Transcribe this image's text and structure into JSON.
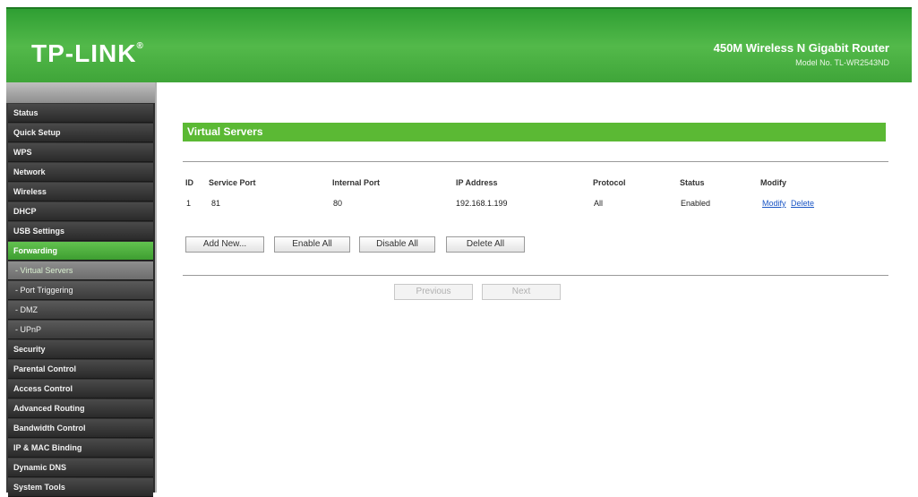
{
  "header": {
    "logo_text": "TP-LINK",
    "logo_mark": "®",
    "product_name": "450M Wireless N Gigabit Router",
    "model_no": "Model No. TL-WR2543ND"
  },
  "sidebar": {
    "items": [
      {
        "label": "Status"
      },
      {
        "label": "Quick Setup"
      },
      {
        "label": "WPS"
      },
      {
        "label": "Network"
      },
      {
        "label": "Wireless"
      },
      {
        "label": "DHCP"
      },
      {
        "label": "USB Settings"
      },
      {
        "label": "Forwarding"
      },
      {
        "label": "- Virtual Servers"
      },
      {
        "label": "- Port Triggering"
      },
      {
        "label": "- DMZ"
      },
      {
        "label": "- UPnP"
      },
      {
        "label": "Security"
      },
      {
        "label": "Parental Control"
      },
      {
        "label": "Access Control"
      },
      {
        "label": "Advanced Routing"
      },
      {
        "label": "Bandwidth Control"
      },
      {
        "label": "IP & MAC Binding"
      },
      {
        "label": "Dynamic DNS"
      },
      {
        "label": "System Tools"
      }
    ]
  },
  "main": {
    "section_title": "Virtual Servers",
    "table": {
      "headers": [
        "ID",
        "Service Port",
        "Internal Port",
        "IP Address",
        "Protocol",
        "Status",
        "Modify"
      ],
      "rows": [
        {
          "id": "1",
          "service_port": "81",
          "internal_port": "80",
          "ip_address": "192.168.1.199",
          "protocol": "All",
          "status": "Enabled",
          "modify_link": "Modify",
          "delete_link": "Delete"
        }
      ]
    },
    "buttons": {
      "add_new": "Add New...",
      "enable_all": "Enable All",
      "disable_all": "Disable All",
      "delete_all": "Delete All"
    },
    "pagination": {
      "previous": "Previous",
      "next": "Next"
    }
  }
}
